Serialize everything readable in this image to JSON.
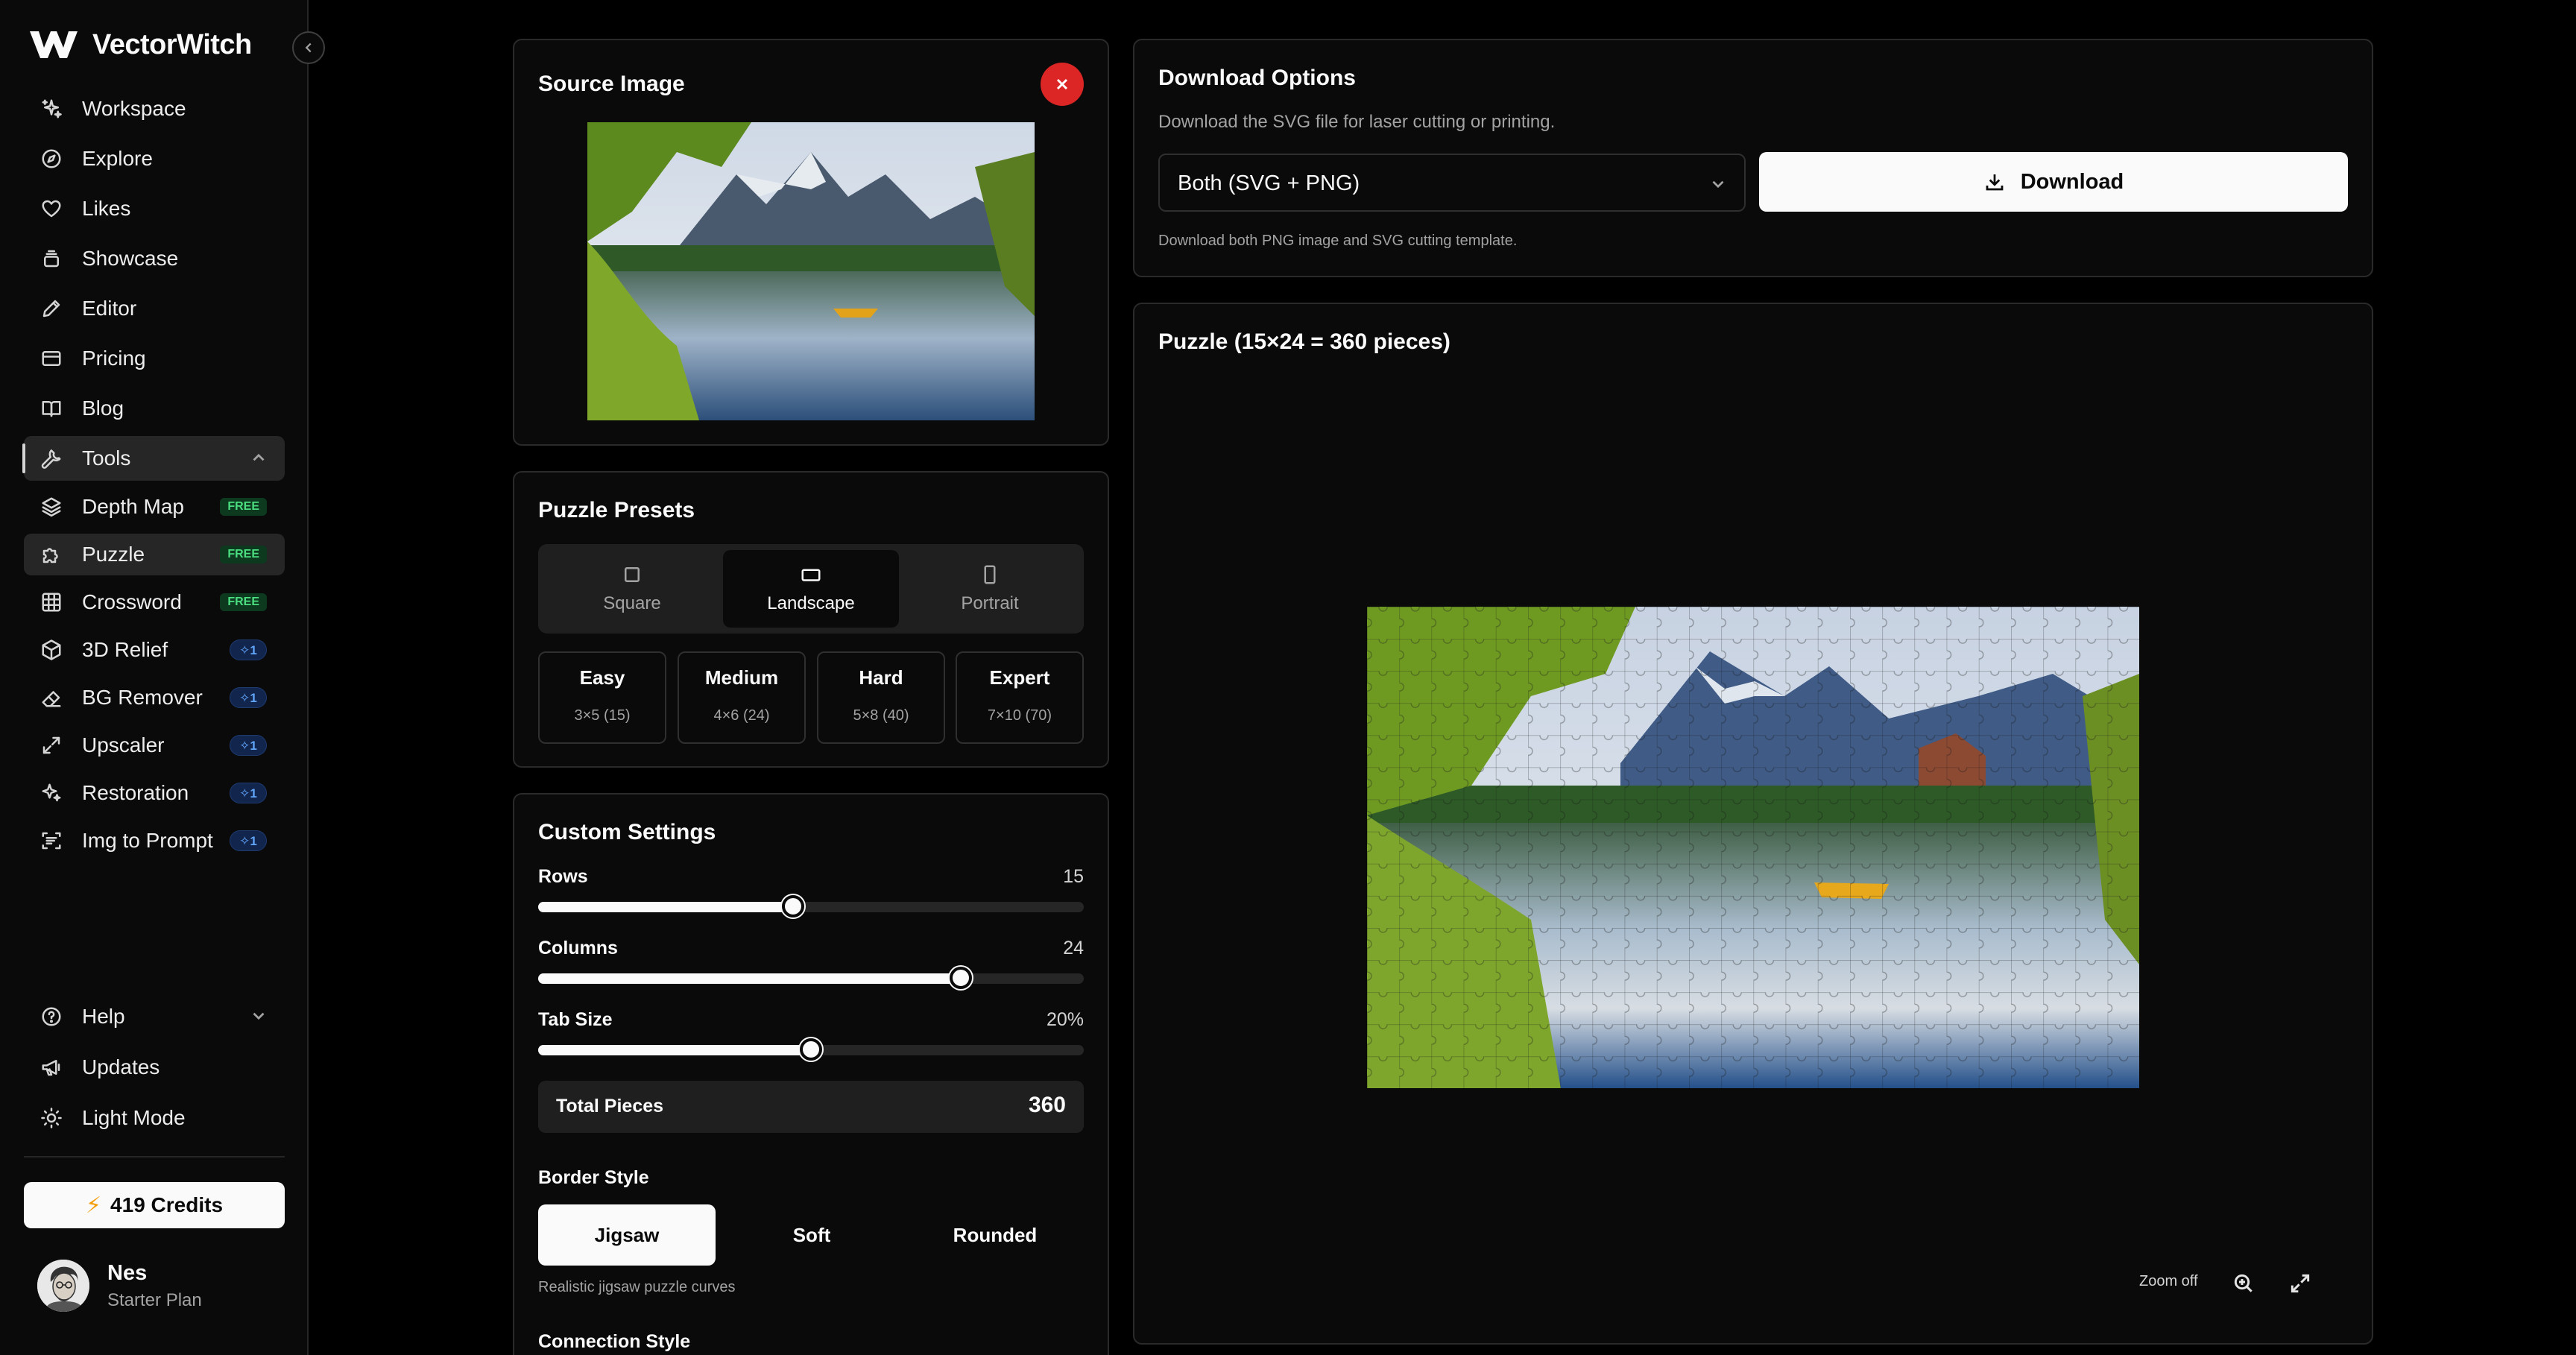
{
  "app": {
    "name": "VectorWitch"
  },
  "sidebar": {
    "items": [
      {
        "label": "Workspace",
        "icon": "sparkles-icon"
      },
      {
        "label": "Explore",
        "icon": "compass-icon"
      },
      {
        "label": "Likes",
        "icon": "heart-icon"
      },
      {
        "label": "Showcase",
        "icon": "layers-stack-icon"
      },
      {
        "label": "Editor",
        "icon": "pencil-icon"
      },
      {
        "label": "Pricing",
        "icon": "credit-card-icon"
      },
      {
        "label": "Blog",
        "icon": "book-open-icon"
      }
    ],
    "tools": {
      "label": "Tools",
      "icon": "wrench-icon",
      "expanded": true,
      "items": [
        {
          "label": "Depth Map",
          "icon": "layers-icon",
          "badge": "FREE",
          "badge_type": "free"
        },
        {
          "label": "Puzzle",
          "icon": "puzzle-icon",
          "badge": "FREE",
          "badge_type": "free",
          "active": true
        },
        {
          "label": "Crossword",
          "icon": "grid-icon",
          "badge": "FREE",
          "badge_type": "free"
        },
        {
          "label": "3D Relief",
          "icon": "cube-icon",
          "badge": "1",
          "badge_type": "credit"
        },
        {
          "label": "BG Remover",
          "icon": "eraser-icon",
          "badge": "1",
          "badge_type": "credit"
        },
        {
          "label": "Upscaler",
          "icon": "expand-arrows-icon",
          "badge": "1",
          "badge_type": "credit"
        },
        {
          "label": "Restoration",
          "icon": "sparkles-icon",
          "badge": "1",
          "badge_type": "credit"
        },
        {
          "label": "Img to Prompt",
          "icon": "text-scan-icon",
          "badge": "1",
          "badge_type": "credit"
        }
      ]
    },
    "bottom": [
      {
        "label": "Help",
        "icon": "help-circle-icon"
      },
      {
        "label": "Updates",
        "icon": "megaphone-icon"
      },
      {
        "label": "Light Mode",
        "icon": "sun-icon"
      }
    ],
    "credits_label": "419 Credits",
    "user": {
      "name": "Nes",
      "plan": "Starter Plan"
    }
  },
  "source": {
    "title": "Source Image"
  },
  "presets": {
    "title": "Puzzle Presets",
    "shapes": [
      {
        "label": "Square",
        "icon": "square-icon"
      },
      {
        "label": "Landscape",
        "icon": "landscape-rect-icon",
        "selected": true
      },
      {
        "label": "Portrait",
        "icon": "portrait-rect-icon"
      }
    ],
    "difficulty": [
      {
        "label": "Easy",
        "sub": "3×5 (15)"
      },
      {
        "label": "Medium",
        "sub": "4×6 (24)"
      },
      {
        "label": "Hard",
        "sub": "5×8 (40)"
      },
      {
        "label": "Expert",
        "sub": "7×10 (70)"
      }
    ]
  },
  "custom": {
    "title": "Custom Settings",
    "rows": {
      "label": "Rows",
      "value": "15",
      "fraction": 0.467
    },
    "columns": {
      "label": "Columns",
      "value": "24",
      "fraction": 0.775
    },
    "tab_size": {
      "label": "Tab Size",
      "value": "20%",
      "fraction": 0.5
    },
    "total": {
      "label": "Total Pieces",
      "value": "360"
    },
    "border": {
      "label": "Border Style",
      "options": [
        "Jigsaw",
        "Soft",
        "Rounded"
      ],
      "selected": "Jigsaw",
      "hint": "Realistic jigsaw puzzle curves"
    },
    "connection_label": "Connection Style"
  },
  "download": {
    "title": "Download Options",
    "subtitle": "Download the SVG file for laser cutting or printing.",
    "format": "Both (SVG + PNG)",
    "button": "Download",
    "hint": "Download both PNG image and SVG cutting template."
  },
  "preview": {
    "title": "Puzzle (15×24 = 360 pieces)",
    "zoom_label": "Zoom off"
  },
  "colors": {
    "close_button": "#dc2626",
    "badge_free": "#4ade80",
    "badge_credit": "#60a5fa",
    "credits_bolt": "#f59e0b"
  }
}
